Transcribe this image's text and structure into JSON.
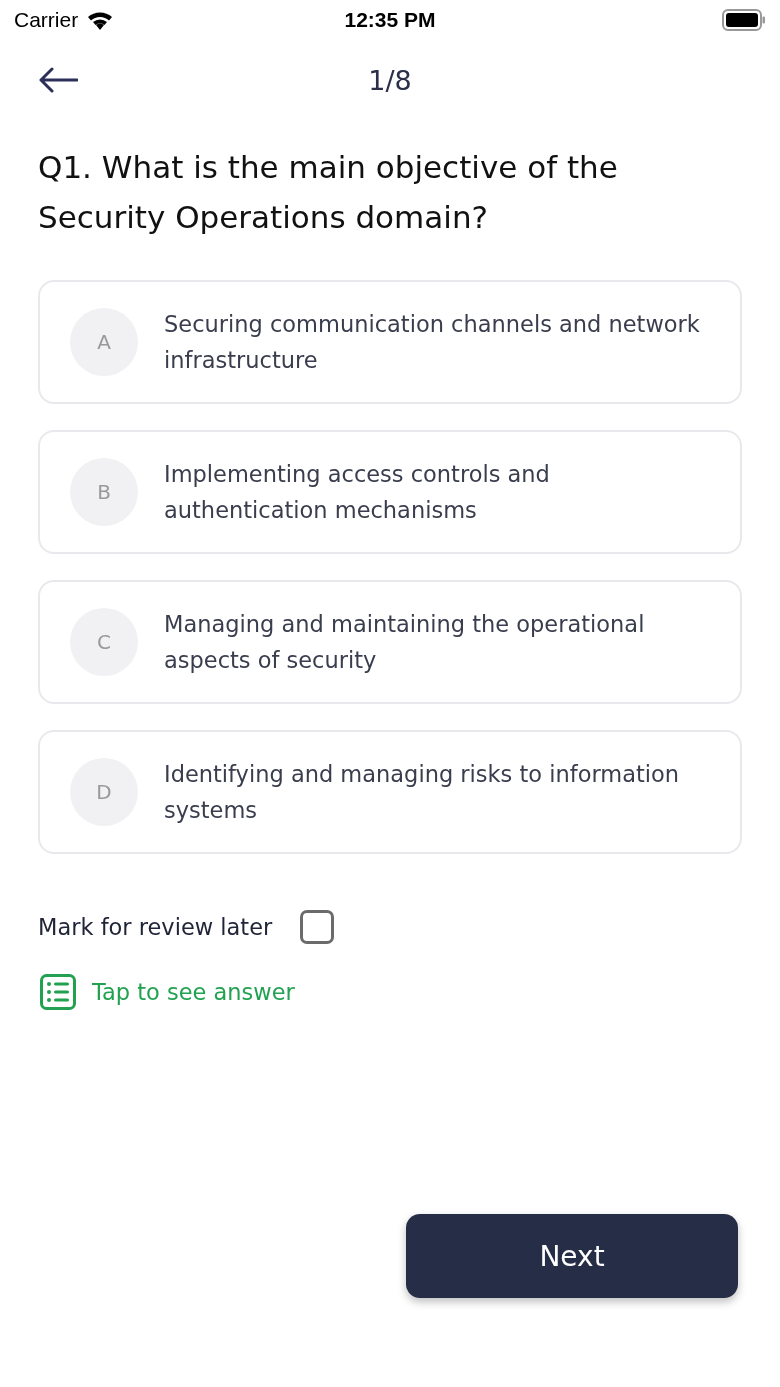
{
  "status_bar": {
    "carrier": "Carrier",
    "time": "12:35 PM"
  },
  "header": {
    "progress": "1/8"
  },
  "question": "Q1. What is the main objective of the Security Operations domain?",
  "options": [
    {
      "letter": "A",
      "text": "Securing communication channels and network infrastructure",
      "selected": false
    },
    {
      "letter": "B",
      "text": "Implementing access controls and authentication mechanisms",
      "selected": false
    },
    {
      "letter": "C",
      "text": "Managing and maintaining the operational aspects of security",
      "selected": false
    },
    {
      "letter": "D",
      "text": "Identifying and managing risks to information systems",
      "selected": false
    }
  ],
  "review": {
    "label": "Mark for review later",
    "checked": false
  },
  "answer_link": "Tap to see answer",
  "next_button": "Next"
}
